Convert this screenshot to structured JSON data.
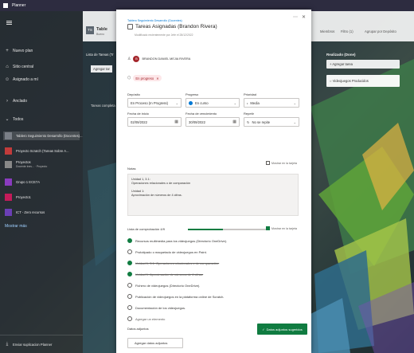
{
  "app": {
    "title": "Planner"
  },
  "sidebar": {
    "items": [
      {
        "icon": "plus-icon",
        "label": "Nuevo plan"
      },
      {
        "icon": "hub-icon",
        "label": "Sitio central"
      },
      {
        "icon": "person-icon",
        "label": "Asignado a mí"
      }
    ],
    "sections": [
      {
        "label": "Anclado"
      },
      {
        "label": "Todos"
      }
    ],
    "plans": [
      {
        "label": "Tablero Seguimiento Desarrollo (Docentes)...",
        "color": "#7a7f87",
        "active": true
      },
      {
        "label": "Proyecto Scratch (Tareas Sobre A...",
        "color": "#c23b3b"
      },
      {
        "label": "Proyectos",
        "sub": "Docente Ines... · Proyecto",
        "color": "#888888"
      },
      {
        "label": "Grupo 1 ECE7A",
        "color": "#8a3bbf"
      },
      {
        "label": "Proyecto1",
        "color": "#c41b5a"
      },
      {
        "label": "ICT - Zero recursos",
        "color": "#6b3fb5"
      }
    ],
    "more": "Mostrar más",
    "footer": "Enviar suplicacion Planner"
  },
  "plan": {
    "tile": "TS",
    "name": "Table",
    "subtitle": "Bueno",
    "left_labels": [
      "Lista de Tareas (Tr",
      "Agregar tar",
      "Tareas completa"
    ],
    "toolbar": [
      "Miembros",
      "Filtro (1)",
      "Agrupar por Depósito"
    ],
    "bucket": {
      "title": "Realizado (Done)",
      "add": "Agregar tarea",
      "card": "Videojuegos Producidos"
    }
  },
  "modal": {
    "breadcrumb": "Tablero Seguimiento Desarrollo (Docentes)",
    "title": "Tareas Asignadas (Brandon Rivera)",
    "last_modified": "Modificado recientemente por Jefe el 28/12/2022",
    "assignee": {
      "initials": "B",
      "name": "BRANDON DANIEL MEJIA RIVERA"
    },
    "label_chip": "En progreso",
    "fields": {
      "bucket": {
        "label": "Depósito",
        "value": "En Proceso (In Progress)"
      },
      "progress": {
        "label": "Progreso",
        "value": "En curso"
      },
      "priority": {
        "label": "Prioridad",
        "value": "Media"
      },
      "start_date": {
        "label": "Fecha de inicio",
        "value": "02/09/2022"
      },
      "due_date": {
        "label": "Fecha de vencimiento",
        "value": "30/09/2022"
      },
      "repeat": {
        "label": "Repetir",
        "value": "No se repite"
      }
    },
    "notes": {
      "label": "Notas",
      "show_on_card": "Mostrar en la tarjeta",
      "lines": [
        "Unidad 1, 3.1:",
        "Operaciones relacionales o de comparación",
        "",
        "Unidad 1:",
        "Aproximación de números de 4 cifras."
      ]
    },
    "checklist": {
      "label": "Lista de comprobación 4/9",
      "progress": 0.44,
      "show_on_card": "Mostrar en la tarjeta",
      "items": [
        {
          "text": "Recursos multimedia para los videojuegos (Directorio OneDrive).",
          "done": true
        },
        {
          "text": "Prototipado o maquetado de videojuegos en Paint.",
          "done": false
        },
        {
          "text": "Unidad 1, 3.1: Operaciones relacionales o de comparación.",
          "done": true
        },
        {
          "text": "Unidad 1: Aproximación de números de 4 cifras.",
          "done": true
        },
        {
          "text": "Fichero de videojuegos (Directorio OneDrive).",
          "done": false
        },
        {
          "text": "Publicación de videojuegos en la plataforma online de Scratch.",
          "done": false
        },
        {
          "text": "Documentación de los videojuegos.",
          "done": false
        },
        {
          "text": "Agregar un elemento",
          "done": false
        }
      ]
    },
    "attachments": {
      "label": "Datos adjuntos",
      "add_button": "Agregar datos adjuntos",
      "green_button": "Datos adjuntos sugeridos"
    }
  },
  "colors": {
    "accent": "#107c41",
    "chip_bg": "#fde7e9",
    "chip_text": "#a4262c",
    "avatar": "#a4262c"
  }
}
